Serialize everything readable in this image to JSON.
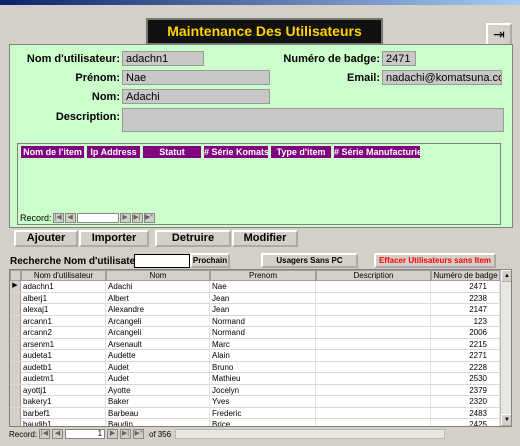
{
  "title": "Maintenance Des Utilisateurs",
  "form": {
    "nom_utilisateur_label": "Nom d'utilisateur:",
    "nom_utilisateur_value": "adachn1",
    "numero_badge_label": "Numéro de badge:",
    "numero_badge_value": "2471",
    "prenom_label": "Prénom:",
    "prenom_value": "Nae",
    "email_label": "Email:",
    "email_value": "nadachi@komatsuna.com",
    "nom_label": "Nom:",
    "nom_value": "Adachi",
    "description_label": "Description:",
    "description_value": ""
  },
  "subform": {
    "columns": [
      "Nom de l'item",
      "Ip Address",
      "Statut",
      "# Série Komatsu",
      "Type d'item",
      "# Série Manufacturier"
    ],
    "record_label": "Record:"
  },
  "buttons": {
    "ajouter": "Ajouter",
    "importer": "Importer",
    "detruire": "Detruire",
    "modifier": "Modifier",
    "prochain": "Prochain",
    "usagers_sans_pc": "Usagers Sans PC",
    "effacer": "Effacer Utilisateurs sans Item"
  },
  "search": {
    "label": "Recherche Nom d'utilisateur:"
  },
  "grid": {
    "columns": [
      "Nom d'utilisateur",
      "Nom",
      "Prenom",
      "Description",
      "Numéro de badge"
    ],
    "rows": [
      [
        "adachn1",
        "Adachi",
        "Nae",
        "",
        "2471"
      ],
      [
        "alberj1",
        "Albert",
        "Jean",
        "",
        "2238"
      ],
      [
        "alexaj1",
        "Alexandre",
        "Jean",
        "",
        "2147"
      ],
      [
        "arcann1",
        "Arcangeli",
        "Normand",
        "",
        "123"
      ],
      [
        "arcann2",
        "Arcangeli",
        "Normand",
        "",
        "2006"
      ],
      [
        "arsenm1",
        "Arsenault",
        "Marc",
        "",
        "2215"
      ],
      [
        "audeta1",
        "Audette",
        "Alain",
        "",
        "2271"
      ],
      [
        "audetb1",
        "Audet",
        "Bruno",
        "",
        "2228"
      ],
      [
        "audetm1",
        "Audet",
        "Mathieu",
        "",
        "2530"
      ],
      [
        "ayottj1",
        "Ayotte",
        "Jocelyn",
        "",
        "2379"
      ],
      [
        "bakery1",
        "Baker",
        "Yves",
        "",
        "2320"
      ],
      [
        "barbef1",
        "Barbeau",
        "Frederic",
        "",
        "2483"
      ],
      [
        "baudib1",
        "Baudin",
        "Brice",
        "",
        "2425"
      ],
      [
        "beaudg1",
        "Beaudin",
        "Guillaume",
        "",
        "2521"
      ]
    ]
  },
  "statusbar": {
    "record_label": "Record:",
    "current": "1",
    "of_label": "of",
    "total": "356"
  },
  "icons": {
    "exit": "exit-door-icon",
    "first": "first-record-icon",
    "prev": "previous-record-icon",
    "next": "next-record-icon",
    "last": "last-record-icon",
    "new": "new-record-icon"
  }
}
